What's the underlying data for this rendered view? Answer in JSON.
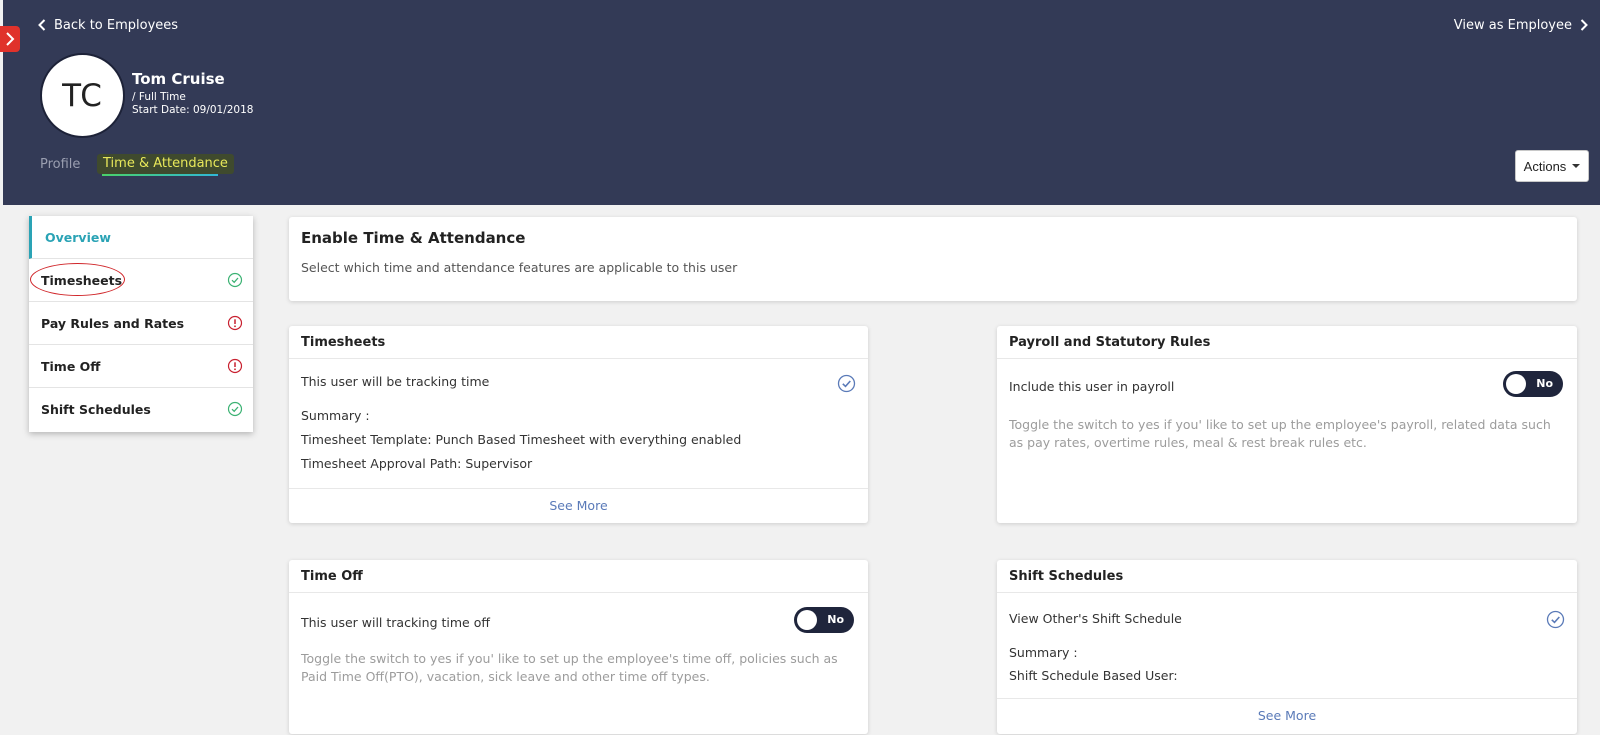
{
  "header": {
    "back_label": "Back to Employees",
    "view_label": "View as Employee",
    "avatar_initials": "TC",
    "employee_name": "Tom Cruise",
    "employee_type": "/ Full Time",
    "start_date": "Start Date: 09/01/2018",
    "tabs": [
      {
        "label": "Profile",
        "active": false
      },
      {
        "label": "Time & Attendance",
        "active": true
      }
    ],
    "actions_label": "Actions"
  },
  "sidebar": {
    "items": [
      {
        "label": "Overview",
        "active": true,
        "status": "none"
      },
      {
        "label": "Timesheets",
        "active": false,
        "status": "ok"
      },
      {
        "label": "Pay Rules and Rates",
        "active": false,
        "status": "warning"
      },
      {
        "label": "Time Off",
        "active": false,
        "status": "warning"
      },
      {
        "label": "Shift Schedules",
        "active": false,
        "status": "ok"
      }
    ]
  },
  "enable": {
    "title": "Enable Time & Attendance",
    "subtitle": "Select which time and attendance features are applicable to this user"
  },
  "timesheets": {
    "title": "Timesheets",
    "tracking": "This user will be tracking time",
    "summary_label": "Summary :",
    "template": "Timesheet Template: Punch Based Timesheet with everything enabled",
    "approval": "Timesheet Approval Path: Supervisor",
    "see_more": "See More"
  },
  "payroll": {
    "title": "Payroll and Statutory Rules",
    "include_label": "Include this user in payroll",
    "toggle_value": "No",
    "help": "Toggle the switch to yes if you' like to set up the employee's payroll, related data such as pay rates, overtime rules, meal & rest break rules etc."
  },
  "time_off": {
    "title": "Time Off",
    "tracking_label": "This user will tracking time off",
    "toggle_value": "No",
    "help": "Toggle the switch to yes if you' like to set up the employee's time off, policies such as Paid Time Off(PTO), vacation, sick leave and other time off types."
  },
  "shift_schedules": {
    "title": "Shift Schedules",
    "view_label": "View Other's Shift Schedule",
    "summary_label": "Summary :",
    "based_user": "Shift Schedule Based User:",
    "see_more": "See More"
  },
  "colors": {
    "header_bg": "#333a56",
    "accent_teal": "#2aa3b5",
    "ok_green": "#3bb273",
    "warning_red": "#c8202f",
    "link_blue": "#5a7ab8",
    "toggle_dark": "#1f253c"
  }
}
